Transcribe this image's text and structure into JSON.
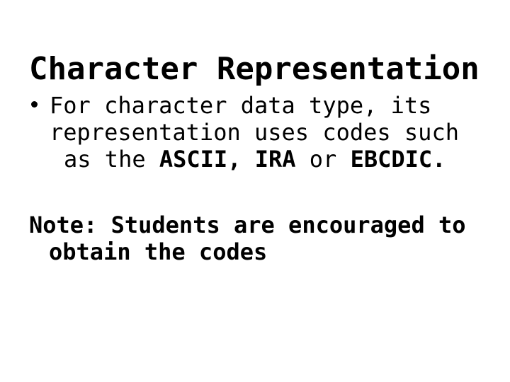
{
  "slide": {
    "background_color": "#ffffff",
    "text_color": "#000000",
    "title": "Character Representation",
    "bullets": [
      {
        "marker": "bullet-dot",
        "lines": [
          {
            "segments": [
              {
                "text": "For character data type, its",
                "bold": false
              }
            ]
          },
          {
            "segments": [
              {
                "text": "representation uses codes such",
                "bold": false
              }
            ]
          },
          {
            "segments": [
              {
                "text": "as the ",
                "bold": false
              },
              {
                "text": "ASCII, IRA",
                "bold": true
              },
              {
                "text": " or ",
                "bold": false
              },
              {
                "text": "EBCDIC.",
                "bold": true
              }
            ]
          }
        ]
      }
    ],
    "note": {
      "lines": [
        "Note: Students are encouraged to",
        "obtain the codes"
      ]
    }
  }
}
